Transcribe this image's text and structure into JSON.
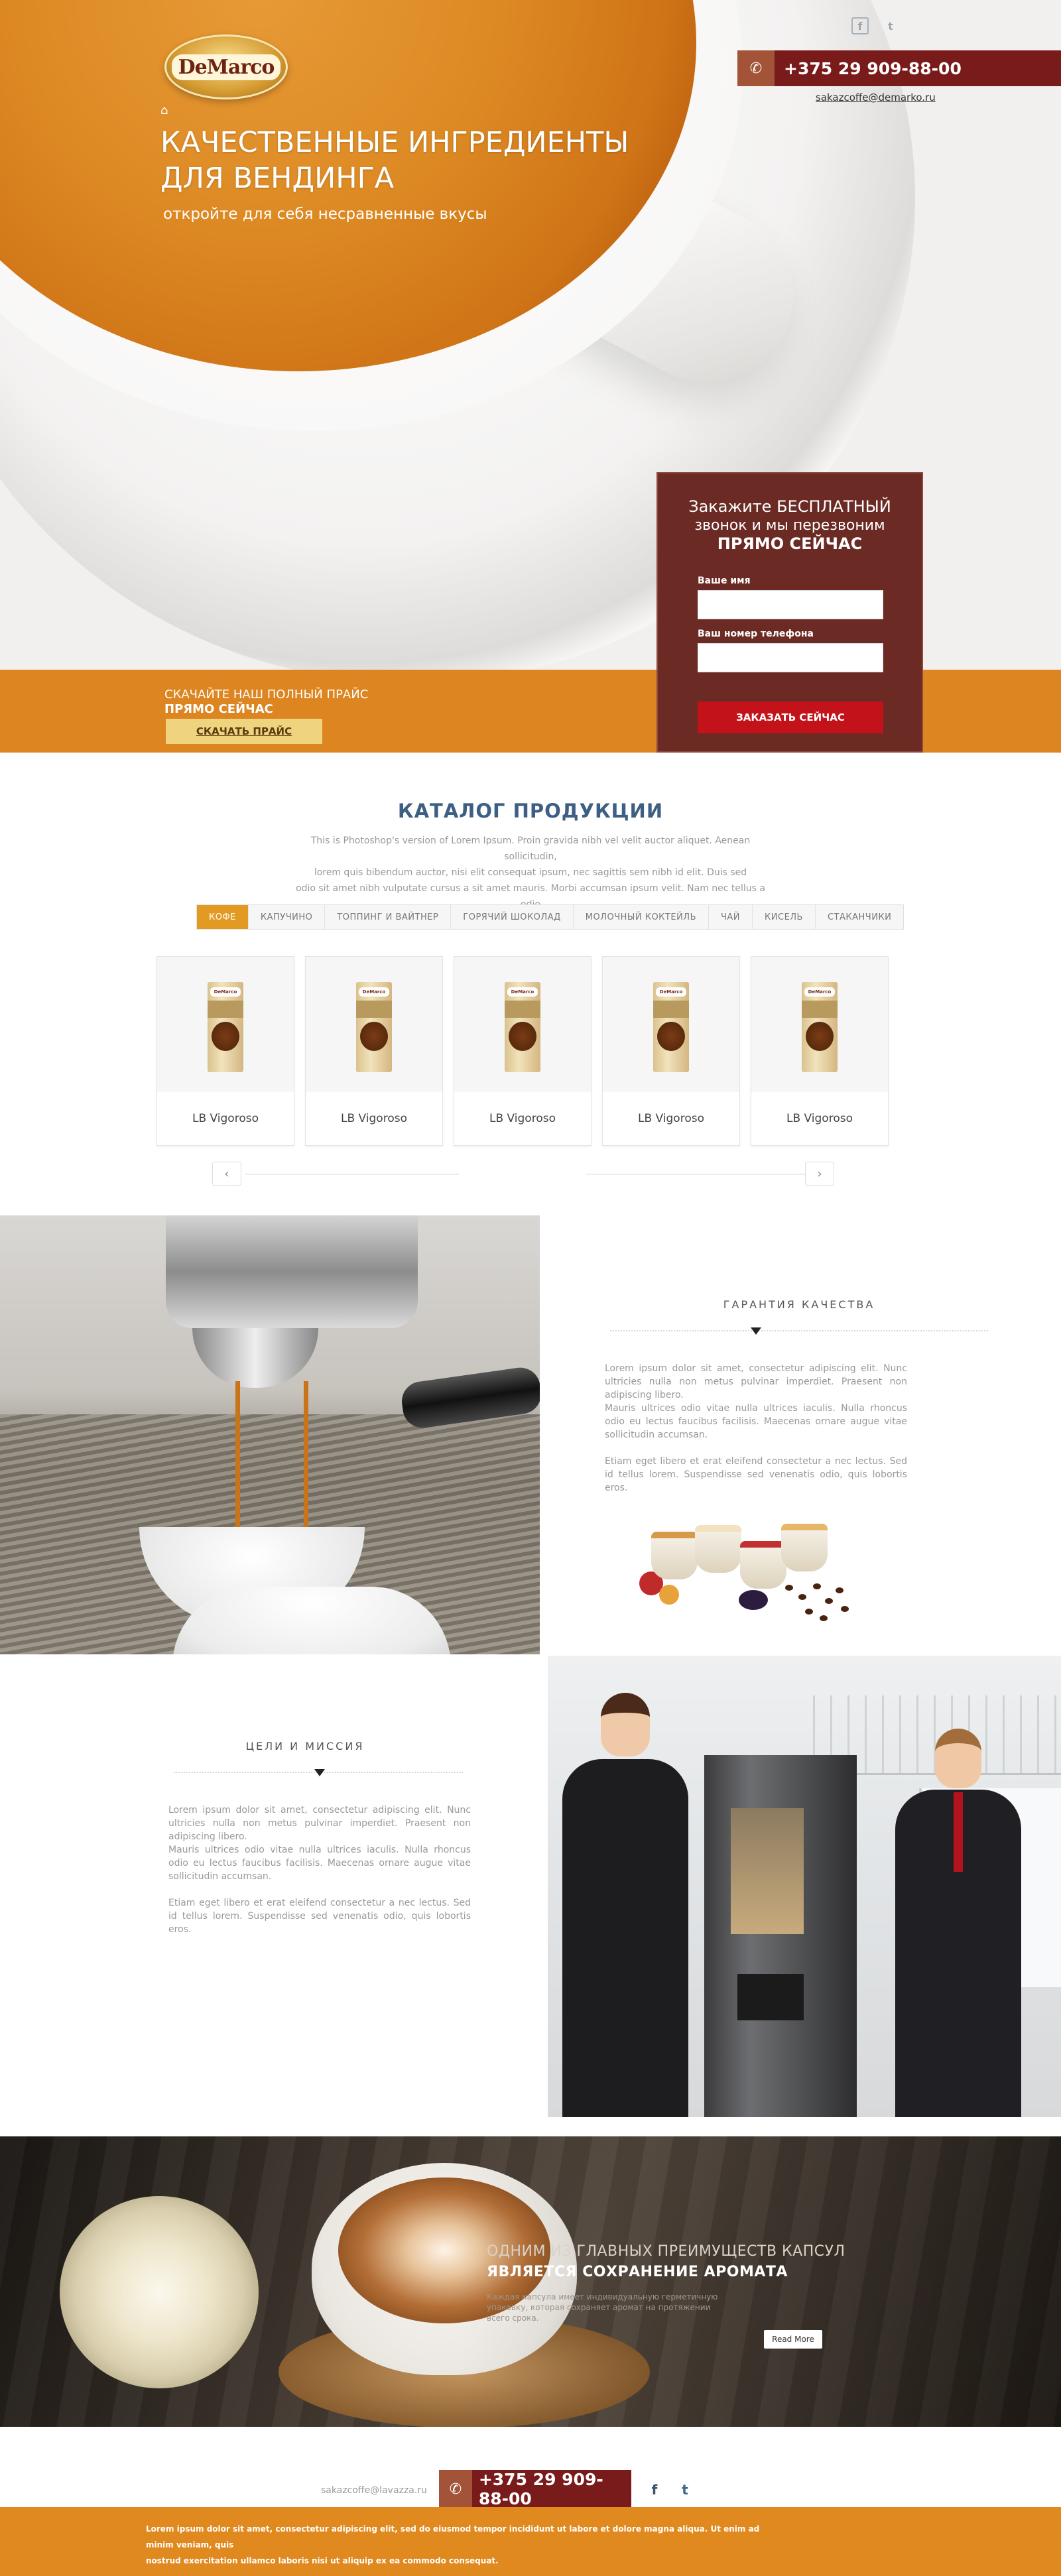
{
  "brand": {
    "logo_text": "DeMarco"
  },
  "header": {
    "phone_icon": "phone-icon",
    "phone": "+375 29 909-88-00",
    "email": "sakazcoffe@demarko.ru",
    "facebook_label": "f",
    "twitter_label": "t",
    "home_icon": "⌂"
  },
  "hero": {
    "title": "КАЧЕСТВЕННЫЕ ИНГРЕДИЕНТЫ ДЛЯ ВЕНДИНГА",
    "subtitle": "откройте для себя несравненные вкусы",
    "price_line1": "СКАЧАЙТЕ НАШ ПОЛНЫЙ ПРАЙС",
    "price_line2": "ПРЯМО СЕЙЧАС",
    "price_button": "СКАЧАТЬ ПРАЙС"
  },
  "callback": {
    "line1": "Закажите БЕСПЛАТНЫЙ",
    "line2": "звонок и мы перезвоним",
    "line3": "ПРЯМО СЕЙЧАС",
    "name_label": "Ваше имя",
    "name_value": "",
    "phone_label": "Ваш номер телефона",
    "phone_value": "",
    "submit": "ЗАКАЗАТЬ СЕЙЧАС"
  },
  "catalog": {
    "title": "КАТАЛОГ ПРОДУКЦИИ",
    "desc_line1": "This is Photoshop's version  of Lorem Ipsum. Proin gravida nibh vel velit auctor aliquet. Aenean sollicitudin,",
    "desc_line2": "lorem quis bibendum auctor, nisi elit consequat ipsum, nec sagittis sem nibh id elit. Duis sed",
    "desc_line3": "odio sit amet nibh vulputate cursus a sit amet mauris. Morbi accumsan ipsum velit. Nam nec tellus a odio",
    "tabs": [
      "КОФЕ",
      "КАПУЧИНО",
      "ТОППИНГ И ВАЙТНЕР",
      "ГОРЯЧИЙ ШОКОЛАД",
      "МОЛОЧНЫЙ КОКТЕЙЛЬ",
      "ЧАЙ",
      "КИСЕЛЬ",
      "СТАКАНЧИКИ"
    ],
    "active_tab": "КОФЕ",
    "products": [
      {
        "name": "LB Vigoroso",
        "pack_brand": "DeMarco"
      },
      {
        "name": "LB Vigoroso",
        "pack_brand": "DeMarco"
      },
      {
        "name": "LB Vigoroso",
        "pack_brand": "DeMarco"
      },
      {
        "name": "LB Vigoroso",
        "pack_brand": "DeMarco"
      },
      {
        "name": "LB Vigoroso",
        "pack_brand": "DeMarco"
      }
    ],
    "prev_icon": "‹",
    "next_icon": "›"
  },
  "quality": {
    "title": "ГАРАНТИЯ КАЧЕСТВА",
    "p1": "Lorem ipsum dolor sit amet, consectetur adipiscing elit. Nunc ultricies nulla non metus pulvinar imperdiet. Praesent non adipiscing libero.",
    "p2": "Mauris ultrices odio vitae nulla ultrices iaculis. Nulla rhoncus odio eu lectus faucibus facilisis. Maecenas ornare augue vitae sollicitudin accumsan.",
    "p3": "Etiam eget libero et erat eleifend consectetur a nec lectus. Sed id tellus lorem. Suspendisse sed venenatis odio, quis lobortis eros."
  },
  "mission": {
    "title": "ЦЕЛИ И МИССИЯ",
    "p1": "Lorem ipsum dolor sit amet, consectetur adipiscing elit. Nunc ultricies nulla non metus pulvinar imperdiet. Praesent non adipiscing libero.",
    "p2": "Mauris ultrices odio vitae nulla ultrices iaculis. Nulla rhoncus odio eu lectus faucibus facilisis. Maecenas ornare augue vitae sollicitudin accumsan.",
    "p3": "Etiam eget libero et erat eleifend consectetur a nec lectus. Sed id tellus lorem. Suspendisse sed venenatis odio, quis lobortis eros."
  },
  "aroma": {
    "line1": "ОДНИМ ИЗ ГЛАВНЫХ ПРЕИМУЩЕСТВ КАПСУЛ",
    "line2": "ЯВЛЯЕТСЯ СОХРАНЕНИЕ АРОМАТА",
    "text": "Каждая капсула имеет индивидуальную герметичную упаковку, которая сохраняет аромат на протяжении всего срока.",
    "button": "Read More"
  },
  "footer": {
    "email": "sakazcoffe@lavazza.ru",
    "phone": "+375 29 909-88-00",
    "facebook_label": "f",
    "twitter_label": "t",
    "text_line1": "Lorem ipsum dolor sit amet, consectetur adipiscing elit, sed do eiusmod tempor incididunt ut labore et dolore magna aliqua. Ut enim ad minim veniam, quis",
    "text_line2": "nostrud exercitation ullamco laboris nisi ut aliquip ex ea commodo consequat."
  },
  "colors": {
    "accent_orange": "#e0891f",
    "maroon": "#7a1b1b",
    "callback_bg": "#6b2a24",
    "submit_red": "#c4121a",
    "catalog_title": "#3d5f84"
  }
}
